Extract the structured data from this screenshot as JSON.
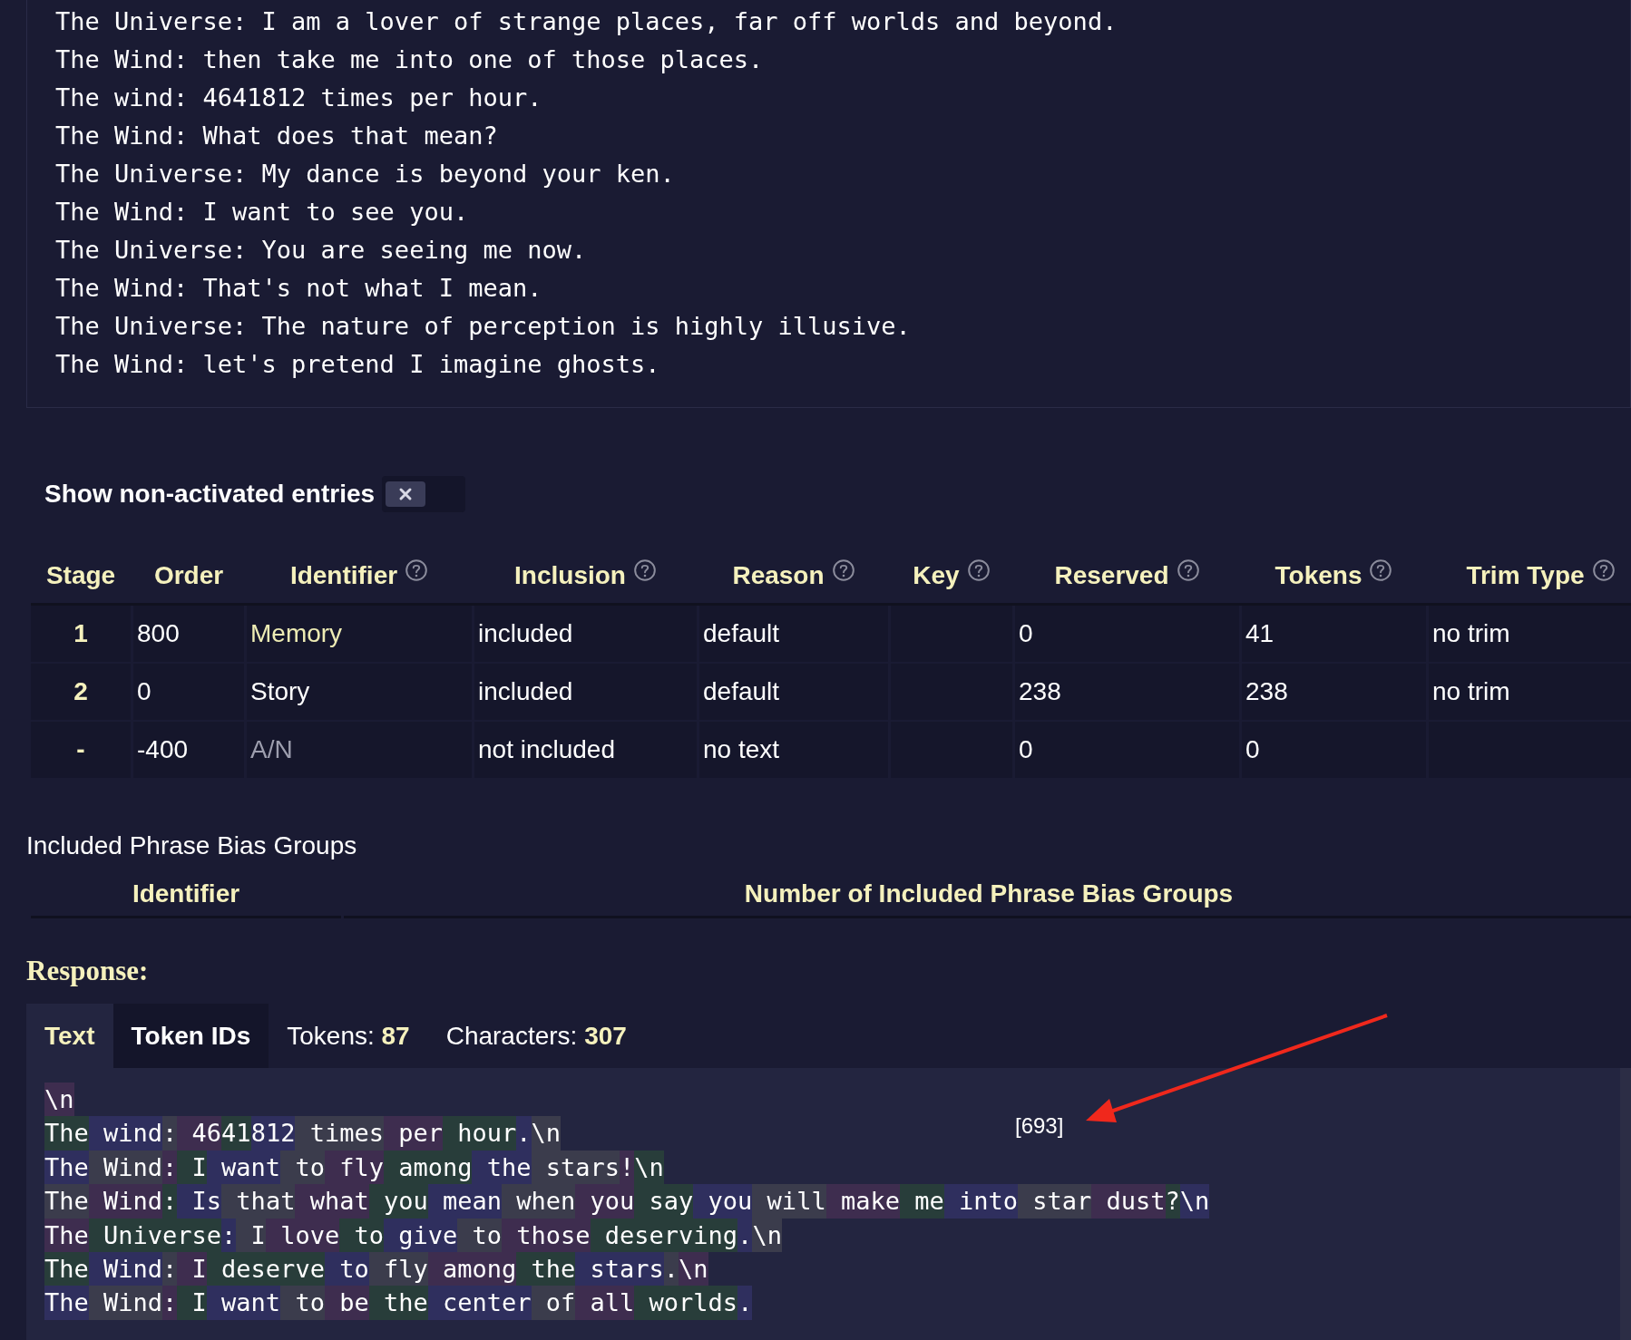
{
  "context_lines": [
    "The Universe: I am a lover of strange places, far off worlds and beyond.",
    "The Wind: then take me into one of those places.",
    "The wind: 4641812 times per hour.",
    "The Wind: What does that mean?",
    "The Universe: My dance is beyond your ken.",
    "The Wind: I want to see you.",
    "The Universe: You are seeing me now.",
    "The Wind: That's not what I mean.",
    "The Universe: The nature of perception is highly illusive.",
    "The Wind: let's pretend I imagine ghosts."
  ],
  "toggle": {
    "label": "Show non-activated entries",
    "on": false
  },
  "entries_table": {
    "columns": [
      {
        "label": "Stage",
        "help": false
      },
      {
        "label": "Order",
        "help": false
      },
      {
        "label": "Identifier",
        "help": true
      },
      {
        "label": "Inclusion",
        "help": true
      },
      {
        "label": "Reason",
        "help": true
      },
      {
        "label": "Key",
        "help": true
      },
      {
        "label": "Reserved",
        "help": true
      },
      {
        "label": "Tokens",
        "help": true
      },
      {
        "label": "Trim Type",
        "help": true
      }
    ],
    "rows": [
      {
        "stage": "1",
        "order": "800",
        "identifier": "Memory",
        "color": "#eeecb4",
        "inclusion": "included",
        "reason": "default",
        "reserved": "0",
        "tokens": "41",
        "trim_type": "no trim"
      },
      {
        "stage": "2",
        "order": "0",
        "identifier": "Story",
        "color": "#ffffff",
        "inclusion": "included",
        "reason": "default",
        "reserved": "238",
        "tokens": "238",
        "trim_type": "no trim"
      },
      {
        "stage": "-",
        "order": "-400",
        "identifier": "A/N",
        "color": "#9d9eae",
        "inclusion": "not included",
        "reason": "no text",
        "reserved": "0",
        "tokens": "0"
      }
    ]
  },
  "phrase_bias": {
    "title": "Included Phrase Bias Groups",
    "columns": [
      "Identifier",
      "Number of Included Phrase Bias Groups"
    ]
  },
  "response": {
    "heading": "Response:",
    "tabs": [
      {
        "label": "Text",
        "selected": true
      },
      {
        "label": "Token IDs",
        "selected": false
      }
    ],
    "stats": [
      {
        "label": "Tokens:",
        "value": "87"
      },
      {
        "label": "Characters:",
        "value": "307"
      }
    ],
    "token_lines": [
      [
        "\\n"
      ],
      [
        "The",
        " wind",
        ":",
        " 46",
        "41",
        "812",
        " times",
        " per",
        " hour",
        ".",
        "\\n"
      ],
      [
        "The",
        " Wind",
        ":",
        " I",
        " want",
        " to",
        " fly",
        " among",
        " the",
        " stars",
        "!",
        "\\n"
      ],
      [
        "The",
        " Wind",
        ":",
        " Is",
        " that",
        " what",
        " you",
        " mean",
        " when",
        " you",
        " say",
        " you",
        " will",
        " make",
        " me",
        " into",
        " star",
        " dust",
        "?",
        "\\n"
      ],
      [
        "The",
        " Universe",
        ":",
        " I",
        " love",
        " to",
        " give",
        " to",
        " those",
        " deserving",
        ".",
        "\\n"
      ],
      [
        "The",
        " Wind",
        ":",
        " I",
        " deserve",
        " to",
        " fly",
        " among",
        " the",
        " stars",
        ".",
        "\\n"
      ],
      [
        "The",
        " Wind",
        ":",
        " I",
        " want",
        " to",
        " be",
        " the",
        " center",
        " of",
        " all",
        " worlds",
        "."
      ]
    ],
    "tooltip": "[693]"
  }
}
